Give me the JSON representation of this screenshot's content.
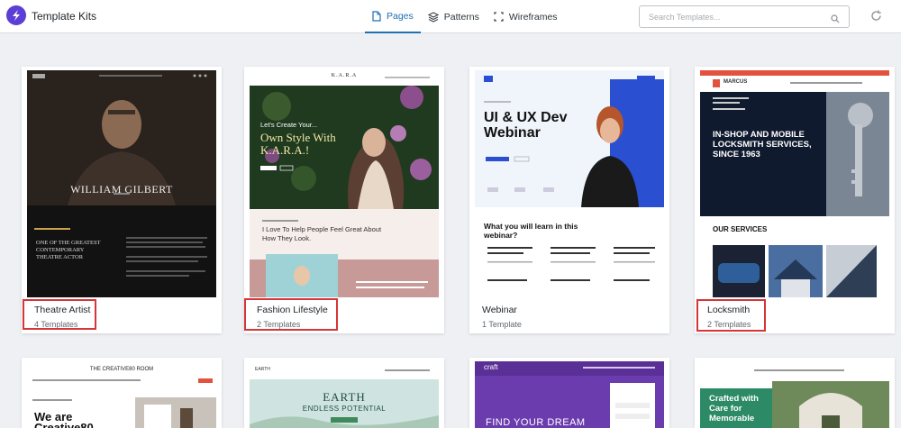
{
  "app": {
    "title": "Template Kits",
    "accent": "#5b3ed6"
  },
  "tabs": [
    {
      "label": "Pages",
      "icon": "file-icon",
      "active": true
    },
    {
      "label": "Patterns",
      "icon": "stack-icon",
      "active": false
    },
    {
      "label": "Wireframes",
      "icon": "wireframe-icon",
      "active": false
    }
  ],
  "search": {
    "placeholder": "Search Templates..."
  },
  "kits": [
    {
      "name": "Theatre Artist",
      "count": "4 Templates",
      "highlighted": true,
      "preview": {
        "hero_name": "WILLIAM GILBERT",
        "headline": "ONE OF THE GREATEST CONTEMPORARY THEATRE ACTOR"
      }
    },
    {
      "name": "Fashion Lifestyle",
      "count": "2 Templates",
      "highlighted": true,
      "preview": {
        "brand": "K.A.R.A",
        "intro": "Let's Create Your...",
        "headline": "Own Style With K.A.R.A.!",
        "tagline": "I Love To Help People Feel Great About How They Look."
      }
    },
    {
      "name": "Webinar",
      "count": "1 Template",
      "highlighted": false,
      "preview": {
        "headline": "UI & UX Dev Webinar",
        "subhead": "What you will learn in this webinar?"
      }
    },
    {
      "name": "Locksmith",
      "count": "2 Templates",
      "highlighted": true,
      "preview": {
        "brand": "MARCUS",
        "headline": "IN-SHOP AND MOBILE LOCKSMITH SERVICES, SINCE 1963",
        "section": "OUR SERVICES"
      }
    }
  ],
  "kits_row2": [
    {
      "preview": {
        "brand": "THE CREATIVE80 ROOM",
        "headline": "We are Creative80"
      }
    },
    {
      "preview": {
        "brand": "EARTH",
        "headline": "EARTH",
        "subhead": "ENDLESS POTENTIAL"
      }
    },
    {
      "preview": {
        "brand": "craft",
        "headline": "FIND YOUR DREAM"
      }
    },
    {
      "preview": {
        "headline": "Crafted with Care for Memorable"
      }
    }
  ],
  "colors": {
    "highlight": "#d63638",
    "active_tab": "#1e6fb4"
  }
}
